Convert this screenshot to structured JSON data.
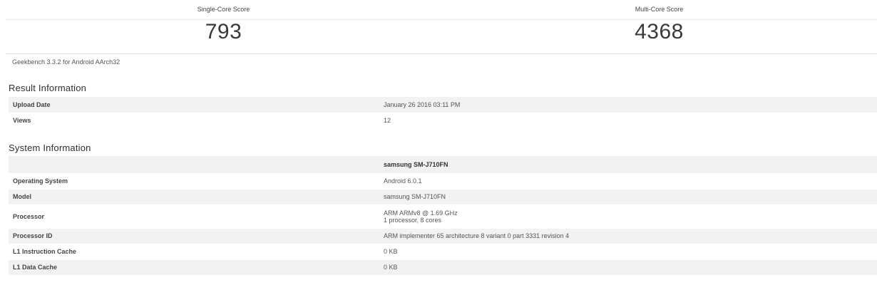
{
  "scores": {
    "single_label": "Single-Core Score",
    "single_value": "793",
    "multi_label": "Multi-Core Score",
    "multi_value": "4368"
  },
  "version": "Geekbench 3.3.2 for Android AArch32",
  "result": {
    "title": "Result Information",
    "rows": [
      {
        "key": "Upload Date",
        "value": "January 26 2016 03:11 PM"
      },
      {
        "key": "Views",
        "value": "12"
      }
    ]
  },
  "system": {
    "title": "System Information",
    "header": "samsung SM-J710FN",
    "rows": [
      {
        "key": "Operating System",
        "value": "Android 6.0.1"
      },
      {
        "key": "Model",
        "value": "samsung SM-J710FN"
      },
      {
        "key": "Processor",
        "value": "ARM ARMv8 @ 1.69 GHz",
        "value2": "1 processor, 8 cores"
      },
      {
        "key": "Processor ID",
        "value": "ARM implementer 65 architecture 8 variant 0 part 3331 revision 4"
      },
      {
        "key": "L1 Instruction Cache",
        "value": "0 KB"
      },
      {
        "key": "L1 Data Cache",
        "value": "0 KB"
      }
    ]
  },
  "colors": {
    "row_shade": "#f2f2f2",
    "text": "#555555",
    "heading": "#2f2f2f"
  }
}
